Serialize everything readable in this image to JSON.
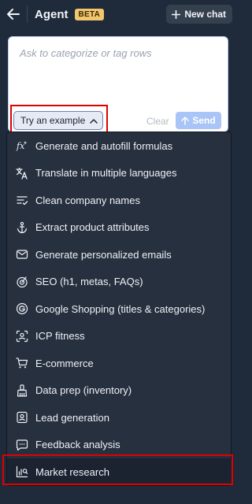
{
  "header": {
    "back_icon": "arrow-left-icon",
    "title": "Agent",
    "badge": "BETA",
    "new_chat_label": "New chat",
    "new_chat_icon": "plus-icon"
  },
  "composer": {
    "placeholder": "Ask to categorize or tag rows",
    "try_example_label": "Try an example",
    "try_example_icon": "chevron-up-icon",
    "clear_label": "Clear",
    "send_label": "Send",
    "send_icon": "arrow-up-icon"
  },
  "menu": {
    "items": [
      {
        "label": "Generate and autofill formulas",
        "icon": "formula-icon"
      },
      {
        "label": "Translate in multiple languages",
        "icon": "translate-icon"
      },
      {
        "label": "Clean company names",
        "icon": "clean-list-icon"
      },
      {
        "label": "Extract product attributes",
        "icon": "anchor-icon"
      },
      {
        "label": "Generate personalized emails",
        "icon": "email-icon"
      },
      {
        "label": "SEO (h1, metas, FAQs)",
        "icon": "seo-icon"
      },
      {
        "label": "Google Shopping (titles & categories)",
        "icon": "google-icon"
      },
      {
        "label": "ICP fitness",
        "icon": "target-user-icon"
      },
      {
        "label": "E-commerce",
        "icon": "cart-icon"
      },
      {
        "label": "Data prep (inventory)",
        "icon": "broom-icon"
      },
      {
        "label": "Lead generation",
        "icon": "contact-card-icon"
      },
      {
        "label": "Feedback analysis",
        "icon": "feedback-icon"
      },
      {
        "label": "Market research",
        "icon": "chart-search-icon",
        "active": true
      }
    ]
  },
  "colors": {
    "background": "#1f2a3a",
    "menu_background": "#27303f",
    "badge": "#f2c66d",
    "send": "#a9c4f7",
    "highlight": "#e00000"
  }
}
